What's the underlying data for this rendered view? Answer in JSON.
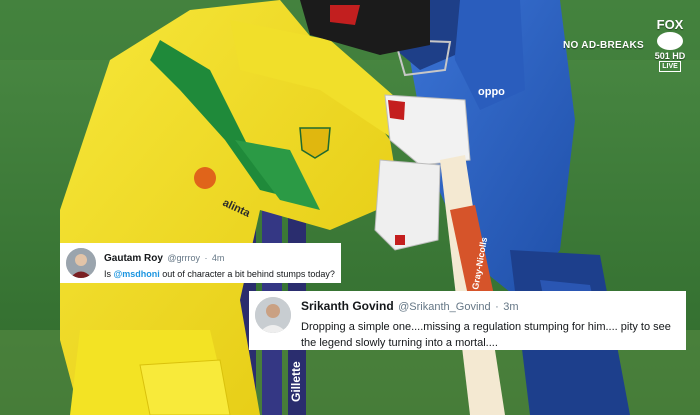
{
  "broadcast": {
    "no_ad_breaks": "NO AD-BREAKS",
    "channel_top": "FOX",
    "channel_number": "501 HD",
    "live": "LIVE"
  },
  "scene": {
    "bat_brand": "Gray-Nicolls",
    "shirt_sponsor": "alinta",
    "stump_sponsor": "Gillette",
    "pad_brand": "Gray-Nicolls",
    "colors": {
      "grass": "#3e7f3a",
      "aus_yellow": "#f2e01a",
      "aus_green": "#1f8a3a",
      "india_blue": "#2f64c8"
    }
  },
  "tweets": [
    {
      "name": "Gautam Roy",
      "handle": "@grrroy",
      "dot": "·",
      "time": "4m",
      "text_before": "Is ",
      "mention": "@msdhoni",
      "text_after": " out of character a bit behind stumps today?"
    },
    {
      "name": "Srikanth Govind",
      "handle": "@Srikanth_Govind",
      "dot": "·",
      "time": "3m",
      "text": "Dropping a simple one....missing a regulation stumping for him.... pity to see the legend slowly turning into a mortal...."
    }
  ]
}
